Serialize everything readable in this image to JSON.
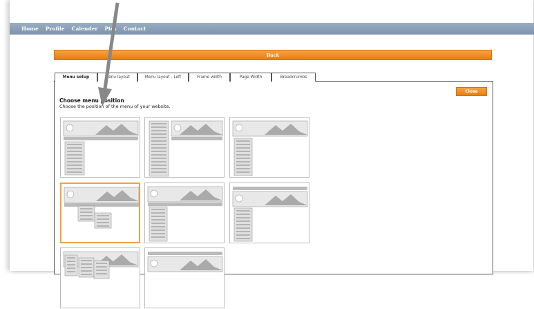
{
  "nav": {
    "items": [
      "Home",
      "Profile",
      "Calender",
      "Pics",
      "Contact"
    ]
  },
  "back_label": "Back",
  "tabs": [
    "Menu setup",
    "Menu layout",
    "Menu layout - Left",
    "Frame width",
    "Page Width",
    "Breadcrumbs"
  ],
  "close_label": "Close",
  "section": {
    "title": "Choose menu position",
    "description": "Choose the position of the menu of your website."
  },
  "options": [
    {
      "layout": "top-menu-left-submenu",
      "selected": false
    },
    {
      "layout": "left-menu-full-height",
      "selected": false
    },
    {
      "layout": "left-submenu-under-header",
      "selected": false
    },
    {
      "layout": "top-menu-staggered-submenus",
      "selected": true
    },
    {
      "layout": "left-menu-under-logo",
      "selected": false
    },
    {
      "layout": "top-menu-left-menu-inset",
      "selected": false
    },
    {
      "layout": "double-left-menu",
      "selected": false
    },
    {
      "layout": "top-menu-simple",
      "selected": false
    }
  ],
  "colors": {
    "accent": "#f0a040",
    "nav": "#8da2ba",
    "border": "#555555"
  },
  "icons": [
    "arrow-pointer-icon",
    "radio-icon",
    "mountain-header-icon",
    "menu-lines-icon"
  ]
}
